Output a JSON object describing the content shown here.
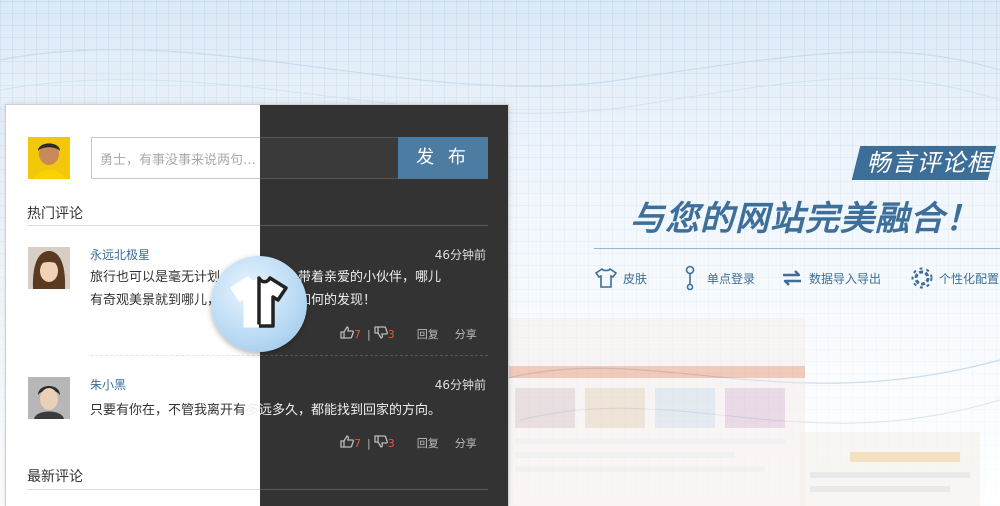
{
  "promo": {
    "tag": "畅言评论框",
    "headline": "与您的网站完美融合！",
    "features": [
      {
        "label": "皮肤",
        "icon": "tshirt-icon"
      },
      {
        "label": "单点登录",
        "icon": "key-icon"
      },
      {
        "label": "数据导入导出",
        "icon": "swap-arrows-icon"
      },
      {
        "label": "个性化配置",
        "icon": "gear-icon"
      }
    ]
  },
  "composer": {
    "placeholder": "勇士，有事没事来说两句…",
    "post_label": "发 布"
  },
  "sections": {
    "hot": "热门评论",
    "latest": "最新评论"
  },
  "comments": [
    {
      "user": "永远北极星",
      "time": "46分钟前",
      "text_light": "旅行也可以是毫无计划，",
      "text_dark": "说走就走，带着亲爱的小伙伴，哪儿",
      "text_light2": "有奇观美景就到哪儿，",
      "text_dark2": "看我们能会有如何的发现！",
      "up": "7",
      "down": "3",
      "reply": "回复",
      "share": "分享"
    },
    {
      "user": "朱小黑",
      "time": "46分钟前",
      "text_light": "只要有你在，不管我离开有",
      "text_dark": "多远多久，都能找到回家的方向。",
      "up": "7",
      "down": "3",
      "reply": "回复",
      "share": "分享"
    }
  ],
  "colors": {
    "accent": "#4d7ca2",
    "dark_skin": "#333333",
    "vote_number": "#e05b2b"
  }
}
